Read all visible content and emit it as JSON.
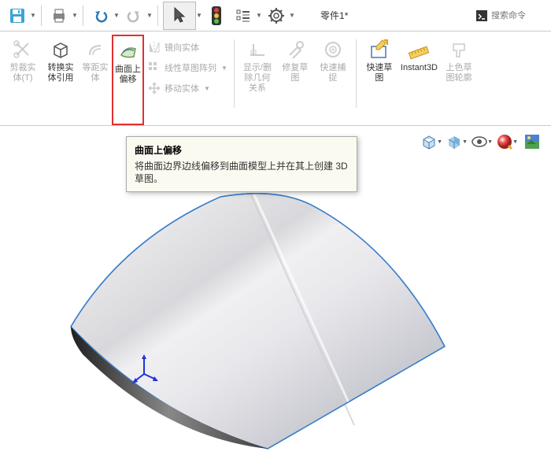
{
  "document": {
    "title": "零件1",
    "asterisk": "*"
  },
  "search": {
    "placeholder": "搜索命令"
  },
  "ribbon": {
    "trim": "剪裁实\n体(T)",
    "convert": "转换实\n体引用",
    "equidistant": "等距实\n体",
    "surfaceOffset": "曲面上\n偏移",
    "mirror": "镜向实体",
    "linearPattern": "线性草图阵列",
    "moveEntity": "移动实体",
    "displayDelete": "显示/删\n除几何\n关系",
    "repairSketch": "修复草\n图",
    "quickSnap": "快速捕\n捉",
    "quickSketch": "快速草\n图",
    "instant3d": "Instant3D",
    "colorSketch": "上色草\n图轮廓"
  },
  "tooltip": {
    "title": "曲面上偏移",
    "body": "将曲面边界边线偏移到曲面模型上并在其上创建 3D 草图。"
  },
  "colors": {
    "highlight": "#e03030",
    "accentBlue": "#2a7ab8",
    "surfaceEdge": "#3b7fc9"
  }
}
